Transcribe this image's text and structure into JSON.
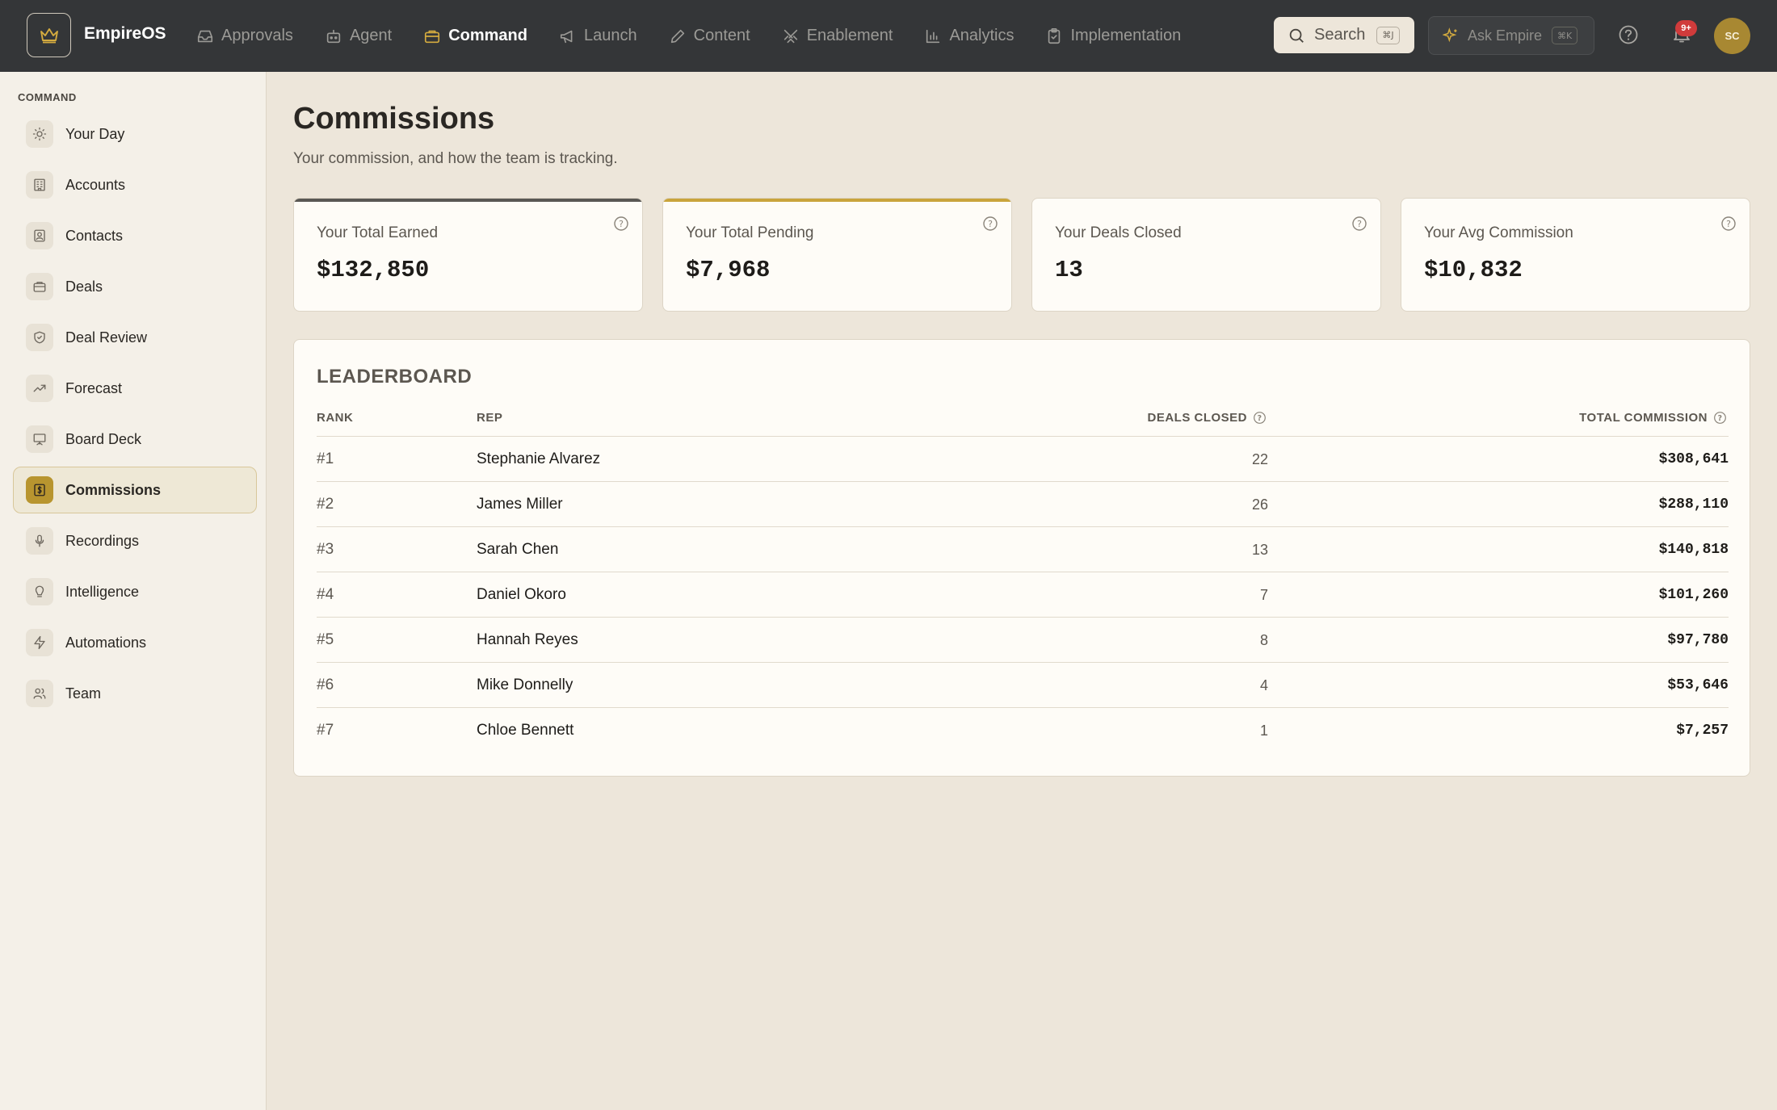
{
  "app": {
    "name": "EmpireOS"
  },
  "nav": [
    {
      "label": "Approvals",
      "icon": "inbox-icon"
    },
    {
      "label": "Agent",
      "icon": "bot-icon"
    },
    {
      "label": "Command",
      "icon": "briefcase-icon",
      "active": true
    },
    {
      "label": "Launch",
      "icon": "megaphone-icon"
    },
    {
      "label": "Content",
      "icon": "pencil-icon"
    },
    {
      "label": "Enablement",
      "icon": "swords-icon"
    },
    {
      "label": "Analytics",
      "icon": "bar-chart-icon"
    },
    {
      "label": "Implementation",
      "icon": "clipboard-check-icon"
    }
  ],
  "search": {
    "label": "Search",
    "shortcut": "⌘J"
  },
  "ask": {
    "label": "Ask Empire",
    "shortcut": "⌘K"
  },
  "notifications": {
    "count": "9+"
  },
  "user": {
    "initials": "SC"
  },
  "sidebar": {
    "heading": "COMMAND",
    "items": [
      {
        "label": "Your Day",
        "icon": "sun-icon"
      },
      {
        "label": "Accounts",
        "icon": "building-icon"
      },
      {
        "label": "Contacts",
        "icon": "contact-card-icon"
      },
      {
        "label": "Deals",
        "icon": "briefcase-icon"
      },
      {
        "label": "Deal Review",
        "icon": "shield-check-icon"
      },
      {
        "label": "Forecast",
        "icon": "trending-up-icon"
      },
      {
        "label": "Board Deck",
        "icon": "presentation-icon"
      },
      {
        "label": "Commissions",
        "icon": "dollar-receipt-icon",
        "active": true
      },
      {
        "label": "Recordings",
        "icon": "microphone-icon"
      },
      {
        "label": "Intelligence",
        "icon": "lightbulb-icon"
      },
      {
        "label": "Automations",
        "icon": "lightning-icon"
      },
      {
        "label": "Team",
        "icon": "users-icon"
      }
    ]
  },
  "page": {
    "title": "Commissions",
    "subtitle": "Your commission, and how the team is tracking."
  },
  "kpis": [
    {
      "label": "Your Total Earned",
      "value": "$132,850",
      "accent": "#5a5854"
    },
    {
      "label": "Your Total Pending",
      "value": "$7,968",
      "accent": "#c9a43c"
    },
    {
      "label": "Your Deals Closed",
      "value": "13",
      "accent": ""
    },
    {
      "label": "Your Avg Commission",
      "value": "$10,832",
      "accent": ""
    }
  ],
  "leaderboard": {
    "title": "LEADERBOARD",
    "columns": {
      "rank": "RANK",
      "rep": "REP",
      "deals": "DEALS CLOSED",
      "commission": "TOTAL COMMISSION"
    },
    "rows": [
      {
        "rank": "#1",
        "rep": "Stephanie Alvarez",
        "deals": "22",
        "commission": "$308,641"
      },
      {
        "rank": "#2",
        "rep": "James Miller",
        "deals": "26",
        "commission": "$288,110"
      },
      {
        "rank": "#3",
        "rep": "Sarah Chen",
        "deals": "13",
        "commission": "$140,818"
      },
      {
        "rank": "#4",
        "rep": "Daniel Okoro",
        "deals": "7",
        "commission": "$101,260"
      },
      {
        "rank": "#5",
        "rep": "Hannah Reyes",
        "deals": "8",
        "commission": "$97,780"
      },
      {
        "rank": "#6",
        "rep": "Mike Donnelly",
        "deals": "4",
        "commission": "$53,646"
      },
      {
        "rank": "#7",
        "rep": "Chloe Bennett",
        "deals": "1",
        "commission": "$7,257"
      }
    ]
  },
  "colors": {
    "topbar": "#343638",
    "accent_gold": "#d4ab3f",
    "background": "#ede6da",
    "card": "#fefcf7",
    "badge": "#d03b3b"
  }
}
